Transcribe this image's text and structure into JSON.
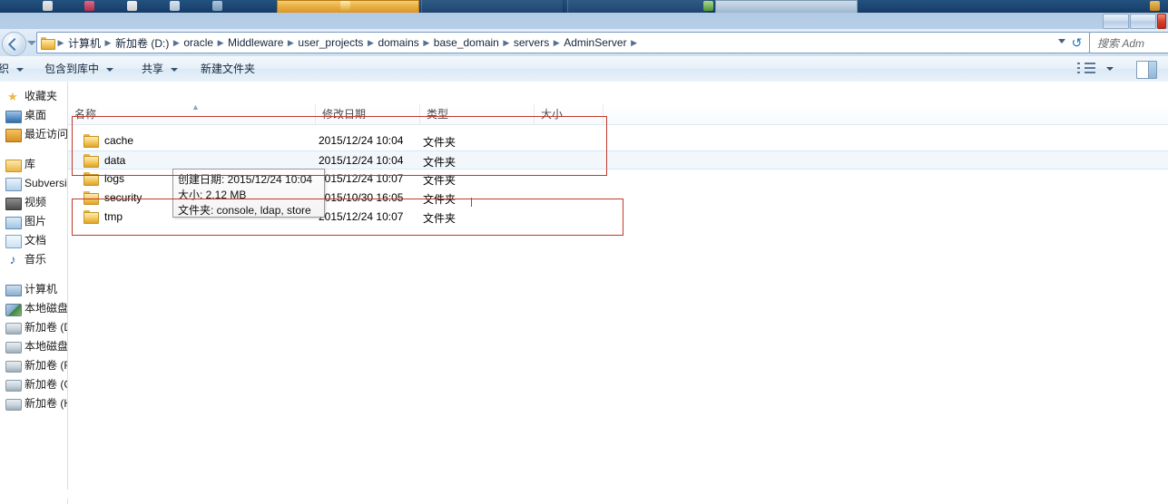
{
  "taskbar": {
    "items": [
      {
        "name": "taskbar-icon-1",
        "color": "#d8d8d8"
      },
      {
        "name": "taskbar-icon-2",
        "color": "#c94f6d"
      },
      {
        "name": "taskbar-icon-3",
        "color": "#e0e0e0"
      },
      {
        "name": "taskbar-icon-4",
        "color": "#cfd8e4"
      },
      {
        "name": "taskbar-icon-5",
        "color": "#9fb8d0"
      },
      {
        "name": "taskbar-button-active",
        "color": "#e8ab3a"
      },
      {
        "name": "taskbar-button-6",
        "color": "#dfe7ef"
      },
      {
        "name": "taskbar-button-7",
        "color": "#7fbf5f"
      },
      {
        "name": "taskbar-button-lit",
        "color": "#c0d2e2"
      }
    ]
  },
  "window": {
    "minimize_label": "",
    "maximize_label": "",
    "close_label": ""
  },
  "address": {
    "back_tooltip": "后退",
    "crumbs": [
      "计算机",
      "新加卷 (D:)",
      "oracle",
      "Middleware",
      "user_projects",
      "domains",
      "base_domain",
      "servers",
      "AdminServer"
    ],
    "separator": "▶",
    "refresh_icon": "refresh-icon",
    "dropdown_icon": "chevron-down-icon"
  },
  "search": {
    "placeholder": "搜索 Adm"
  },
  "toolbar": {
    "organize": "织",
    "include_in_library": "包含到库中",
    "share": "共享",
    "new_folder": "新建文件夹",
    "view_icon": "view-options-icon",
    "preview_pane_icon": "preview-pane-icon"
  },
  "sidebar": {
    "groups": [
      {
        "header": {
          "label": "收藏夹",
          "icon": "favorites-star-icon"
        },
        "items": [
          {
            "label": "桌面",
            "icon": "desktop-icon"
          },
          {
            "label": "最近访问的",
            "icon": "recent-places-icon"
          }
        ]
      },
      {
        "header": {
          "label": "库",
          "icon": "library-icon"
        },
        "items": [
          {
            "label": "Subversio",
            "icon": "subversion-icon"
          },
          {
            "label": "视频",
            "icon": "videos-icon"
          },
          {
            "label": "图片",
            "icon": "pictures-icon"
          },
          {
            "label": "文档",
            "icon": "documents-icon"
          },
          {
            "label": "音乐",
            "icon": "music-icon"
          }
        ]
      },
      {
        "header": {
          "label": "计算机",
          "icon": "computer-icon"
        },
        "items": [
          {
            "label": "本地磁盘",
            "icon": "local-disk-c-icon"
          },
          {
            "label": "新加卷 (D",
            "icon": "drive-icon"
          },
          {
            "label": "本地磁盘",
            "icon": "drive-icon"
          },
          {
            "label": "新加卷 (F:",
            "icon": "drive-icon"
          },
          {
            "label": "新加卷 (G",
            "icon": "drive-icon"
          },
          {
            "label": "新加卷 (H",
            "icon": "drive-icon"
          }
        ]
      }
    ]
  },
  "filelist": {
    "columns": [
      {
        "label": "名称",
        "sorted": true
      },
      {
        "label": "修改日期",
        "sorted": false
      },
      {
        "label": "类型",
        "sorted": false
      },
      {
        "label": "大小",
        "sorted": false
      }
    ],
    "sort_indicator": "▲",
    "rows": [
      {
        "name": "cache",
        "date": "2015/12/24 10:04",
        "type": "文件夹",
        "size": "",
        "selected": false
      },
      {
        "name": "data",
        "date": "2015/12/24 10:04",
        "type": "文件夹",
        "size": "",
        "selected": true
      },
      {
        "name": "logs",
        "date": "2015/12/24 10:07",
        "type": "文件夹",
        "size": "",
        "selected": false
      },
      {
        "name": "security",
        "date": "2015/10/30 16:05",
        "type": "文件夹",
        "size": "",
        "selected": false
      },
      {
        "name": "tmp",
        "date": "2015/12/24 10:07",
        "type": "文件夹",
        "size": "",
        "selected": false
      }
    ]
  },
  "tooltip": {
    "line1": "创建日期: 2015/12/24 10:04",
    "line2": "大小: 2.12 MB",
    "line3": "文件夹: console, ldap, store"
  },
  "annotations": {
    "color": "#c0392b",
    "box_top_label": "highlight-cache-data-logs",
    "box_bottom_label": "highlight-tmp-area",
    "tick_label": "annotation-tick"
  }
}
